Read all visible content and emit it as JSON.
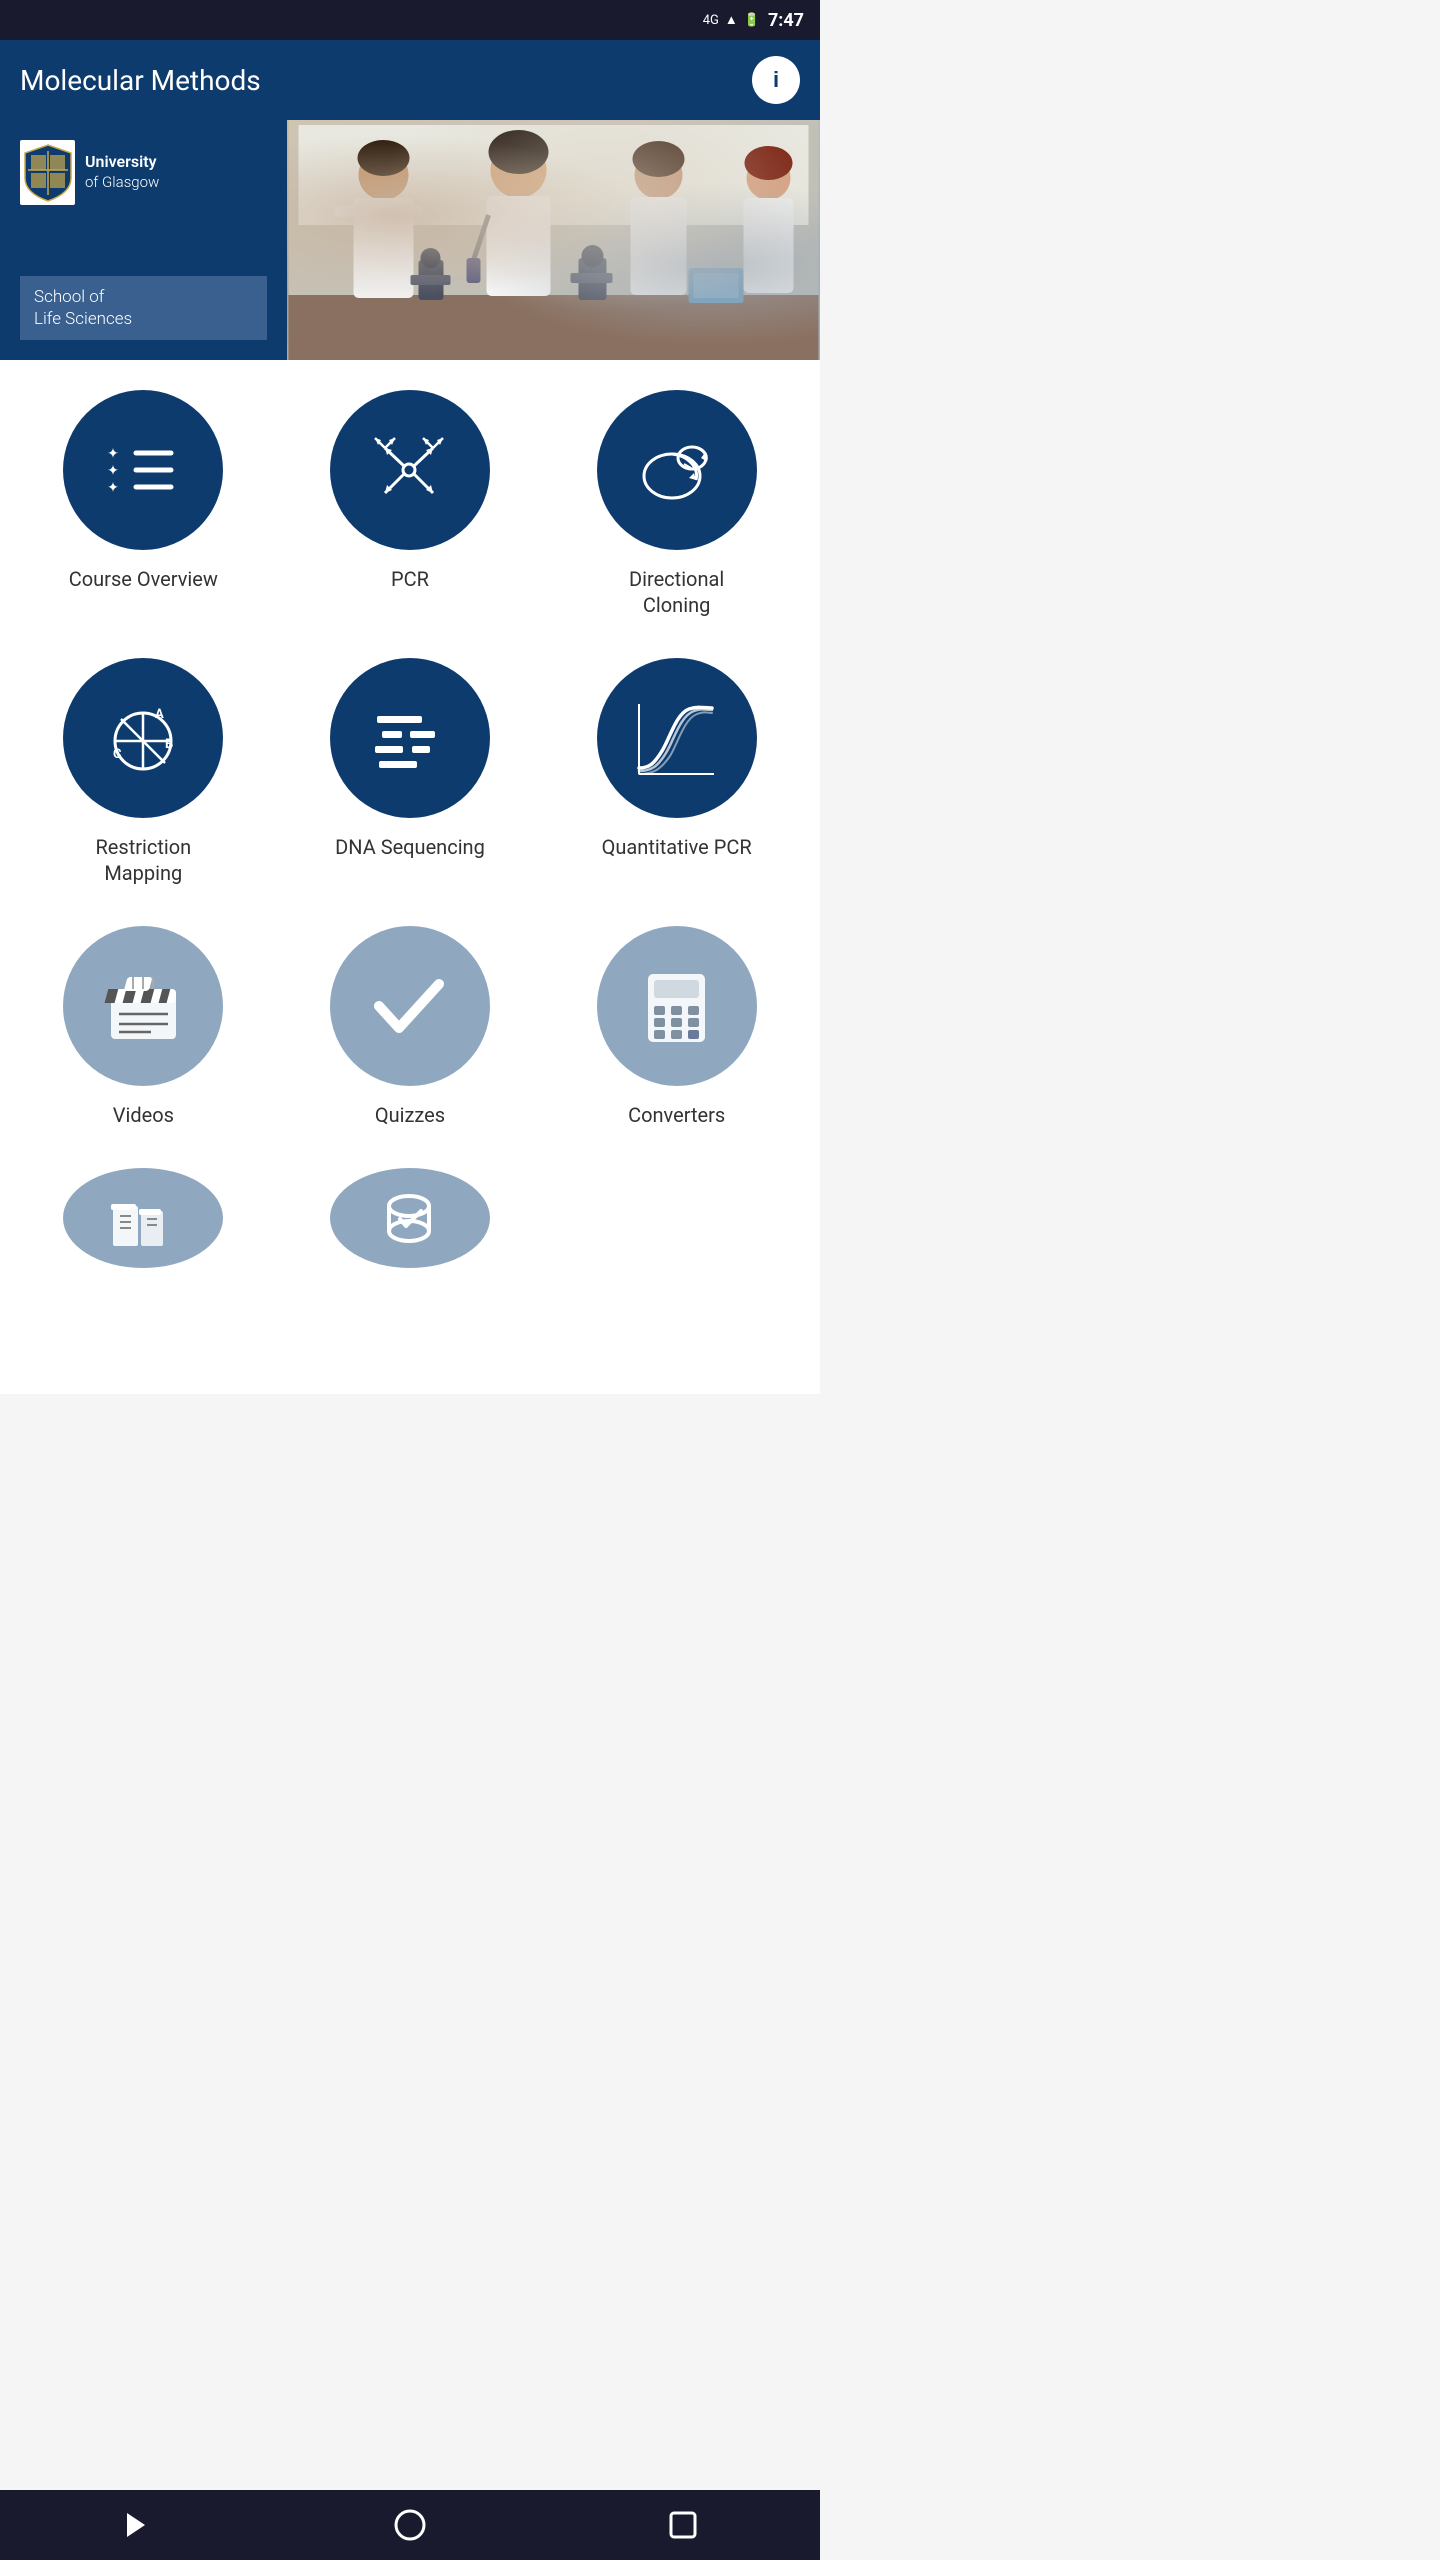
{
  "statusBar": {
    "time": "7:47",
    "signal": "4G",
    "battery": "🔋"
  },
  "appBar": {
    "title": "Molecular Methods",
    "infoButton": "i"
  },
  "banner": {
    "universityName": "University\nof Glasgow",
    "schoolLabel": "School of\nLife Sciences"
  },
  "grid": {
    "items": [
      {
        "id": "course-overview",
        "label": "Course Overview",
        "iconType": "dark",
        "iconName": "list-star-icon"
      },
      {
        "id": "pcr",
        "label": "PCR",
        "iconType": "dark",
        "iconName": "pcr-icon"
      },
      {
        "id": "directional-cloning",
        "label": "Directional\nCloning",
        "iconType": "dark",
        "iconName": "cloning-icon"
      },
      {
        "id": "restriction-mapping",
        "label": "Restriction\nMapping",
        "iconType": "dark",
        "iconName": "restriction-icon"
      },
      {
        "id": "dna-sequencing",
        "label": "DNA Sequencing",
        "iconType": "dark",
        "iconName": "sequencing-icon"
      },
      {
        "id": "quantitative-pcr",
        "label": "Quantitative PCR",
        "iconType": "dark",
        "iconName": "qpcr-icon"
      },
      {
        "id": "videos",
        "label": "Videos",
        "iconType": "light",
        "iconName": "clapperboard-icon"
      },
      {
        "id": "quizzes",
        "label": "Quizzes",
        "iconType": "light",
        "iconName": "checkmark-icon"
      },
      {
        "id": "converters",
        "label": "Converters",
        "iconType": "light",
        "iconName": "calculator-icon"
      },
      {
        "id": "books",
        "label": "",
        "iconType": "light",
        "iconName": "books-icon"
      },
      {
        "id": "tools",
        "label": "",
        "iconType": "light",
        "iconName": "tools-icon"
      }
    ]
  },
  "navBar": {
    "backLabel": "back",
    "homeLabel": "home",
    "recentLabel": "recent"
  },
  "colors": {
    "darkBlue": "#0d3b6e",
    "lightBlue": "#8fa8c0",
    "background": "#ffffff"
  }
}
